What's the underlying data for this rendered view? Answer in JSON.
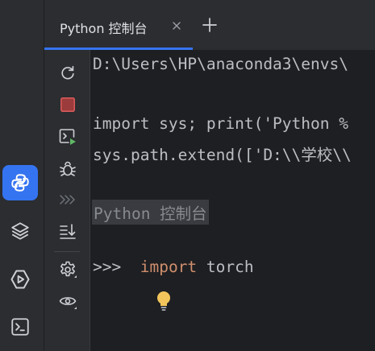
{
  "tab": {
    "label": "Python 控制台"
  },
  "console": {
    "lines": [
      "D:\\Users\\HP\\anaconda3\\envs\\",
      "import sys; print('Python %",
      "sys.path.extend(['D:\\\\学校\\\\"
    ],
    "header": "Python 控制台",
    "prompt": ">>>",
    "input_keyword": "import",
    "input_rest": " torch"
  },
  "icons": {
    "stripe": [
      "python-console-icon",
      "layers-icon",
      "services-icon",
      "terminal-icon"
    ],
    "toolbar": [
      "rerun-icon",
      "stop-icon",
      "run-selection-icon",
      "debug-icon",
      "history-icon",
      "scroll-to-end-icon",
      "settings-icon",
      "variables-view-icon"
    ]
  },
  "colors": {
    "accent": "#3574f0",
    "keyword": "#cf8e6d",
    "text": "#bcbec4",
    "stop": "#db5c5c",
    "run": "#5fb865",
    "bulb": "#f2c55c"
  }
}
